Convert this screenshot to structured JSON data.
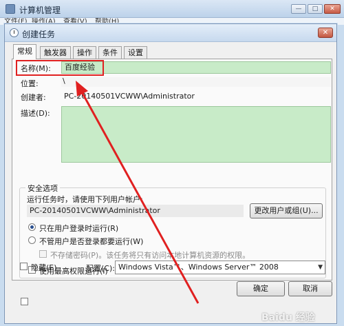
{
  "parent_window": {
    "title": "计算机管理",
    "menu": [
      "文件(F)",
      "操作(A)",
      "查看(V)",
      "帮助(H)"
    ],
    "controls": {
      "minimize": "—",
      "maximize": "□",
      "close": "✕"
    }
  },
  "dialog": {
    "title": "创建任务",
    "close": "✕",
    "tabs": [
      "常规",
      "触发器",
      "操作",
      "条件",
      "设置"
    ],
    "general": {
      "name_label": "名称(M):",
      "name_value": "百度经验",
      "location_label": "位置:",
      "location_value": "\\",
      "author_label": "创建者:",
      "author_value": "PC-20140501VCWW\\Administrator",
      "description_label": "描述(D):",
      "security": {
        "title": "安全选项",
        "run_as_prompt": "运行任务时，请使用下列用户帐户:",
        "user_account": "PC-20140501VCWW\\Administrator",
        "change_user_button": "更改用户或组(U)...",
        "opt_logged_on": "只在用户登录时运行(R)",
        "opt_whether_logged": "不管用户是否登录都要运行(W)",
        "opt_no_password": "不存储密码(P)。该任务将只有访问本地计算机资源的权限。",
        "opt_highest": "使用最高权限运行(I)"
      },
      "hidden_label": "隐藏(E)",
      "configure_label": "配置(C):",
      "configure_value": "Windows Vista™、Windows Server™ 2008"
    },
    "ok_button": "确定",
    "cancel_button": "取消"
  },
  "watermark": "Baidu 经验",
  "colors": {
    "annotation": "#e02020",
    "field_highlight": "#c8ebc8"
  }
}
